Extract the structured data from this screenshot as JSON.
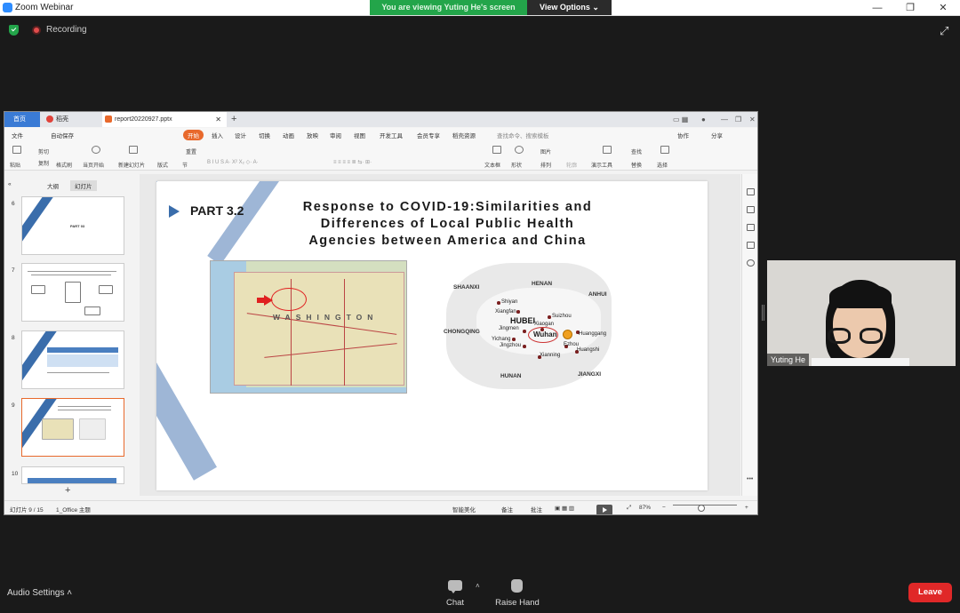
{
  "window": {
    "title": "Zoom Webinar",
    "minimize": "—",
    "maximize": "❐",
    "close": "✕"
  },
  "banner": {
    "viewing": "You are viewing Yuting He's screen",
    "view_options": "View Options ⌄"
  },
  "status": {
    "recording": "Recording"
  },
  "wps": {
    "tabs": {
      "home": "首页",
      "doc1": "稻壳",
      "doc2": "report20220927.pptx"
    },
    "menu": [
      "文件",
      "自动保存",
      "开始",
      "插入",
      "设计",
      "切换",
      "动画",
      "放映",
      "审阅",
      "视图",
      "开发工具",
      "会员专享",
      "稻壳资源",
      "查找命令、搜索模板",
      "协作",
      "分享"
    ],
    "ribbon": [
      "粘贴",
      "剪切",
      "复制",
      "格式刷",
      "当页开始",
      "新建幻灯片",
      "版式",
      "节",
      "重置",
      "文本框",
      "形状",
      "图片",
      "排列",
      "轮廓",
      "演示工具",
      "替换",
      "选择",
      "查找"
    ],
    "side_tabs": [
      "大纲",
      "幻灯片"
    ],
    "thumbs": [
      {
        "num": "6",
        "text": "PART 03"
      },
      {
        "num": "7",
        "text": ""
      },
      {
        "num": "8",
        "text": ""
      },
      {
        "num": "9",
        "text": ""
      },
      {
        "num": "10",
        "text": ""
      }
    ],
    "add_slide": "+",
    "slide": {
      "part": "PART 3.2",
      "title_lines": [
        "Response to COVID-19:Similarities and",
        "Differences of Local Public Health",
        "Agencies between America and China"
      ],
      "wa_label": "WASHINGTON",
      "hubei": {
        "provinces": [
          "SHAANXI",
          "HENAN",
          "ANHUI",
          "CHONGQING",
          "HUNAN",
          "JIANGXI"
        ],
        "name": "HUBEI",
        "cities": [
          "Shiyan",
          "Xiangfan",
          "Suizhou",
          "Jingmen",
          "Xiaogan",
          "Wuhan",
          "Huanggang",
          "Yichang",
          "Jingzhou",
          "Ezhou",
          "Huangshi",
          "Xianning"
        ]
      }
    },
    "statusbar": {
      "slide_count": "幻灯片 9 / 15",
      "theme": "1_Office 主题",
      "smart": "智能美化",
      "notes": "备注",
      "comments": "批注",
      "zoom": "87%",
      "minus": "−",
      "plus": "+"
    }
  },
  "participant": {
    "name": "Yuting He"
  },
  "toolbar": {
    "audio": "Audio Settings",
    "chat": "Chat",
    "raise_hand": "Raise Hand",
    "leave": "Leave"
  }
}
